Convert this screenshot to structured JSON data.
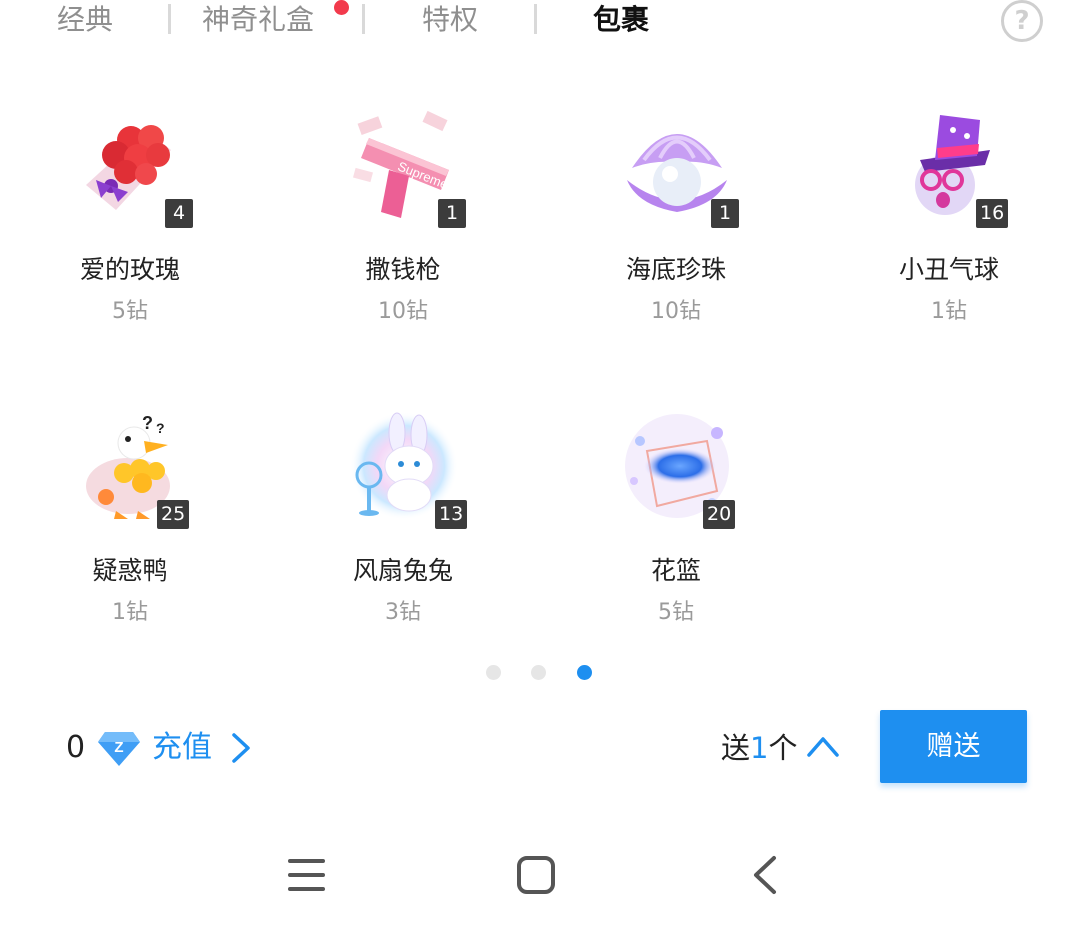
{
  "tabs": [
    {
      "label": "经典",
      "active": false
    },
    {
      "label": "神奇礼盒",
      "active": false,
      "has_badge": true
    },
    {
      "label": "特权",
      "active": false
    },
    {
      "label": "包裹",
      "active": true
    }
  ],
  "help_icon": "question-circle-icon",
  "gifts": [
    {
      "name": "爱的玫瑰",
      "price": "5钻",
      "count": "4",
      "icon": "rose-bouquet"
    },
    {
      "name": "撒钱枪",
      "price": "10钻",
      "count": "1",
      "icon": "money-gun"
    },
    {
      "name": "海底珍珠",
      "price": "10钻",
      "count": "1",
      "icon": "pearl-shell"
    },
    {
      "name": "小丑气球",
      "price": "1钻",
      "count": "16",
      "icon": "clown-balloon"
    },
    {
      "name": "疑惑鸭",
      "price": "1钻",
      "count": "25",
      "icon": "confused-duck"
    },
    {
      "name": "风扇兔兔",
      "price": "3钻",
      "count": "13",
      "icon": "fan-bunny"
    },
    {
      "name": "花篮",
      "price": "5钻",
      "count": "20",
      "icon": "flower-basket"
    }
  ],
  "pager": {
    "total": 3,
    "current": 3
  },
  "wallet": {
    "balance": "0",
    "currency_icon": "blue-diamond-icon",
    "recharge_label": "充值"
  },
  "send": {
    "prefix": "送",
    "quantity": "1",
    "suffix": "个",
    "button_label": "赠送"
  },
  "system_nav": [
    "menu-icon",
    "home-icon",
    "back-icon"
  ],
  "colors": {
    "accent": "#1e8ff0",
    "badge_red": "#f23a4c",
    "count_badge": "#3c3c3c",
    "muted_text": "#9a9a9a"
  }
}
